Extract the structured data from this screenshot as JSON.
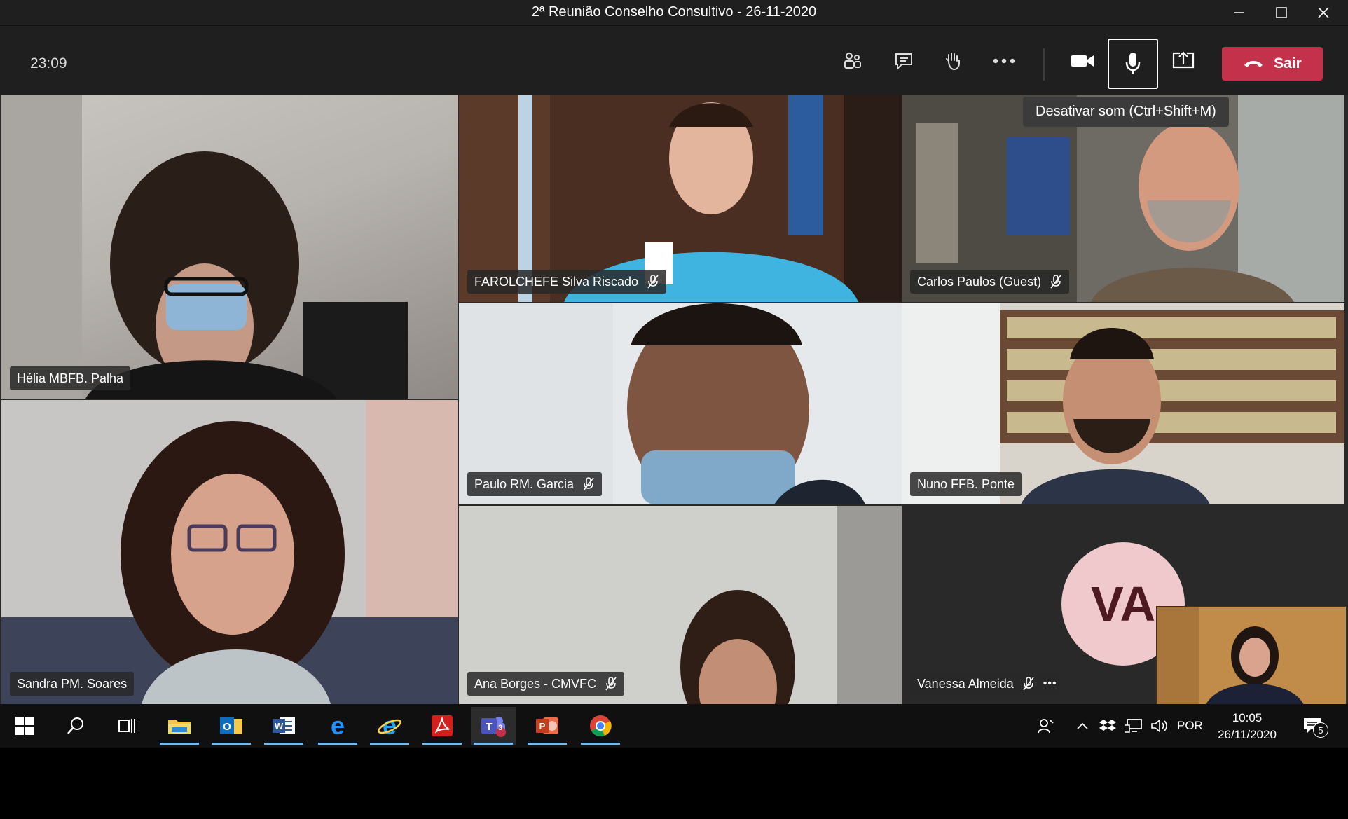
{
  "window": {
    "title": "2ª Reunião Conselho Consultivo - 26-11-2020"
  },
  "toolbar": {
    "timer": "23:09",
    "buttons": [
      "participants-icon",
      "chat-icon",
      "raise-hand-icon",
      "more-icon",
      "camera-icon",
      "microphone-icon",
      "share-screen-icon"
    ],
    "leave_label": "Sair",
    "tooltip": "Desativar som (Ctrl+Shift+M)",
    "leave_color": "#c4314b"
  },
  "participants": [
    {
      "name": "Hélia MBFB. Palha",
      "muted": false
    },
    {
      "name": "FAROLCHEFE Silva Riscado",
      "muted": true
    },
    {
      "name": "Carlos Paulos (Guest)",
      "muted": true
    },
    {
      "name": "Paulo RM. Garcia",
      "muted": true
    },
    {
      "name": "Nuno FFB. Ponte",
      "muted": false
    },
    {
      "name": "Sandra PM. Soares",
      "muted": false
    },
    {
      "name": "Ana Borges - CMVFC",
      "muted": true
    },
    {
      "name": "Vanessa Almeida",
      "muted": true,
      "initials": "VA",
      "more": "•••"
    }
  ],
  "taskbar": {
    "apps": [
      "windows-start-icon",
      "search-icon",
      "task-view-icon",
      "file-explorer-icon",
      "outlook-icon",
      "word-icon",
      "edge-icon",
      "internet-explorer-icon",
      "acrobat-icon",
      "teams-icon",
      "powerpoint-icon",
      "chrome-icon"
    ],
    "teams_badge": "3",
    "language": "POR",
    "time": "10:05",
    "date": "26/11/2020",
    "notifications_badge": "5"
  }
}
